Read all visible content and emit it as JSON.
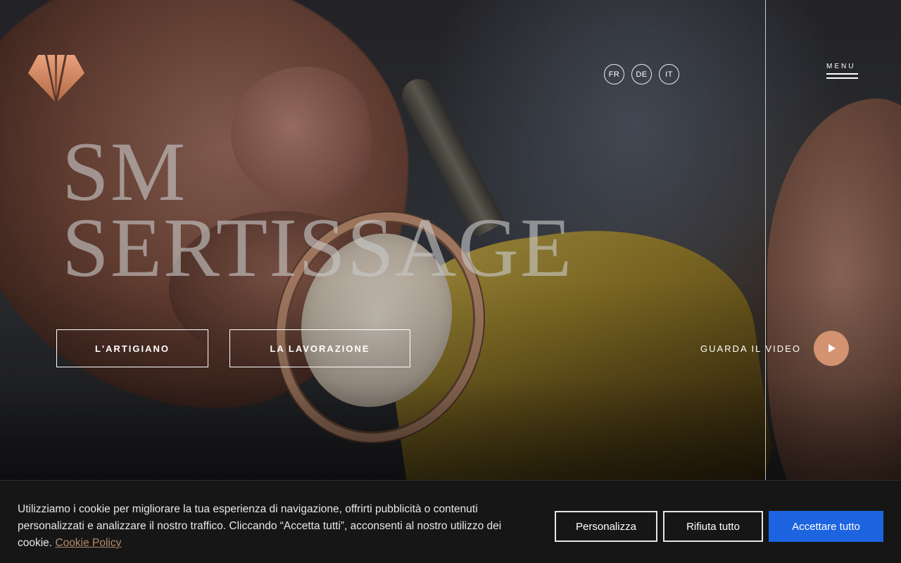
{
  "header": {
    "languages": [
      "FR",
      "DE",
      "IT"
    ],
    "menu_label": "MENU"
  },
  "hero": {
    "title_line1": "SM",
    "title_line2": "SERTISSAGE",
    "cta_artigiano": "L'ARTIGIANO",
    "cta_lavorazione": "LA LAVORAZIONE",
    "video_label": "GUARDA IL VIDEO"
  },
  "cookie": {
    "text": "Utilizziamo i cookie per migliorare la tua esperienza di navigazione, offrirti pubblicità o contenuti personalizzati e analizzare il nostro traffico. Cliccando “Accetta tutti”, acconsenti al nostro utilizzo dei cookie.",
    "policy_link": "Cookie Policy",
    "personalize_label": "Personalizza",
    "reject_label": "Rifiuta tutto",
    "accept_label": "Accettare tutto"
  },
  "colors": {
    "accent": "#d39370",
    "accept_button": "#1c64e0",
    "link": "#b88a6a"
  },
  "icons": {
    "logo": "diamond-logo-icon",
    "play": "play-icon"
  }
}
